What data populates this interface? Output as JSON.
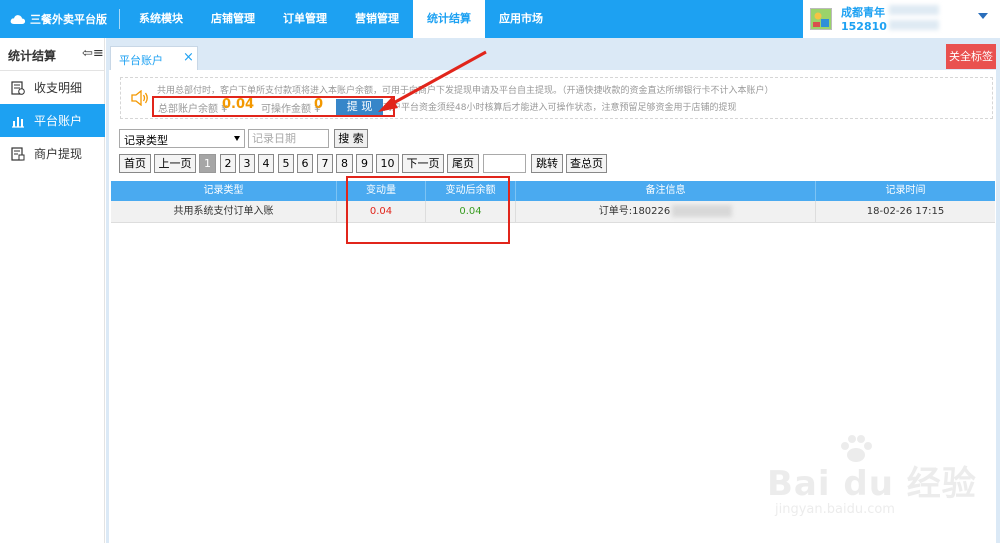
{
  "topbar": {
    "brand": "三餐外卖平台版",
    "nav": [
      "系统模块",
      "店铺管理",
      "订单管理",
      "营销管理",
      "统计结算",
      "应用市场"
    ],
    "active_nav": "统计结算",
    "user_name": "成都青年",
    "user_phone": "152810"
  },
  "sidebar": {
    "title": "统计结算",
    "items": [
      {
        "label": "收支明细",
        "icon": "ledger-icon"
      },
      {
        "label": "平台账户",
        "icon": "bar-chart-icon"
      },
      {
        "label": "商户提现",
        "icon": "withdraw-icon"
      }
    ],
    "active_item": "平台账户"
  },
  "tabs": {
    "current": "平台账户",
    "close_all": "关全标签"
  },
  "notice": {
    "line1": "共用总部付时，客户下单所支付款项将进入本账户余额，可用于向商户下发提现申请及平台自主提现。（开通快捷收款的资金直达所绑银行卡不计入本账户）",
    "line2": "商户平台资金须经48小时核算后才能进入可操作状态，注意预留足够资金用于店铺的提现",
    "total_label": "总部账户余额 ¥",
    "total_value": "0.04",
    "available_label": "可操作金额 ¥",
    "available_value": "0",
    "withdraw_button": "提 现"
  },
  "filter": {
    "type_select": "记录类型",
    "date_placeholder": "记录日期",
    "search_button": "搜 索"
  },
  "pager": {
    "first": "首页",
    "prev": "上一页",
    "pages": [
      "1",
      "2",
      "3",
      "4",
      "5",
      "6",
      "7",
      "8",
      "9",
      "10"
    ],
    "current_page": "1",
    "next": "下一页",
    "last": "尾页",
    "jump": "跳转",
    "total": "查总页"
  },
  "table": {
    "headers": [
      "记录类型",
      "变动量",
      "变动后余额",
      "备注信息",
      "记录时间"
    ],
    "rows": [
      {
        "type": "共用系统支付订单入账",
        "change": "0.04",
        "balance": "0.04",
        "note": "订单号:180226",
        "time": "18-02-26 17:15"
      }
    ]
  },
  "watermark": {
    "main": "Bai du 经验",
    "sub": "jingyan.baidu.com"
  },
  "colors": {
    "primary": "#1da1f2",
    "accent_orange": "#f39800",
    "annotation_red": "#e1251b",
    "close_all_bg": "#e9514f",
    "positive_green": "#3a9d23"
  }
}
